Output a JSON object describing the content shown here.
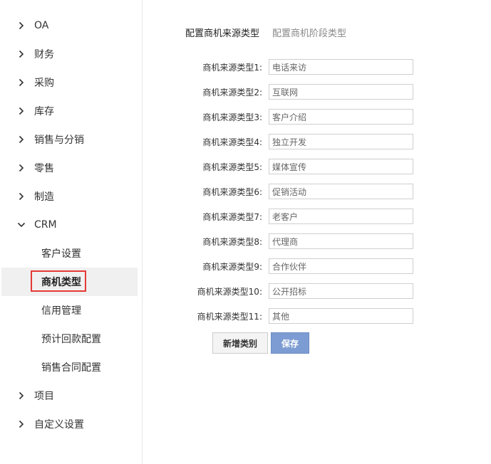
{
  "sidebar": {
    "items": [
      {
        "label": "OA"
      },
      {
        "label": "财务"
      },
      {
        "label": "采购"
      },
      {
        "label": "库存"
      },
      {
        "label": "销售与分销"
      },
      {
        "label": "零售"
      },
      {
        "label": "制造"
      },
      {
        "label": "CRM"
      }
    ],
    "crm_sub": [
      {
        "label": "客户设置"
      },
      {
        "label": "商机类型"
      },
      {
        "label": "信用管理"
      },
      {
        "label": "预计回款配置"
      },
      {
        "label": "销售合同配置"
      }
    ],
    "after": [
      {
        "label": "项目"
      },
      {
        "label": "自定义设置"
      }
    ],
    "active_highlight_color": "#e53935"
  },
  "tabs": {
    "active": "配置商机来源类型",
    "inactive": "配置商机阶段类型"
  },
  "form": {
    "rows": [
      {
        "label": "商机来源类型1:",
        "value": "电话来访"
      },
      {
        "label": "商机来源类型2:",
        "value": "互联网"
      },
      {
        "label": "商机来源类型3:",
        "value": "客户介绍"
      },
      {
        "label": "商机来源类型4:",
        "value": "独立开发"
      },
      {
        "label": "商机来源类型5:",
        "value": "媒体宣传"
      },
      {
        "label": "商机来源类型6:",
        "value": "促销活动"
      },
      {
        "label": "商机来源类型7:",
        "value": "老客户"
      },
      {
        "label": "商机来源类型8:",
        "value": "代理商"
      },
      {
        "label": "商机来源类型9:",
        "value": "合作伙伴"
      },
      {
        "label": "商机来源类型10:",
        "value": "公开招标"
      },
      {
        "label": "商机来源类型11:",
        "value": "其他"
      }
    ]
  },
  "buttons": {
    "add_label": "新增类别",
    "save_label": "保存",
    "save_color": "#7d9cd3"
  }
}
